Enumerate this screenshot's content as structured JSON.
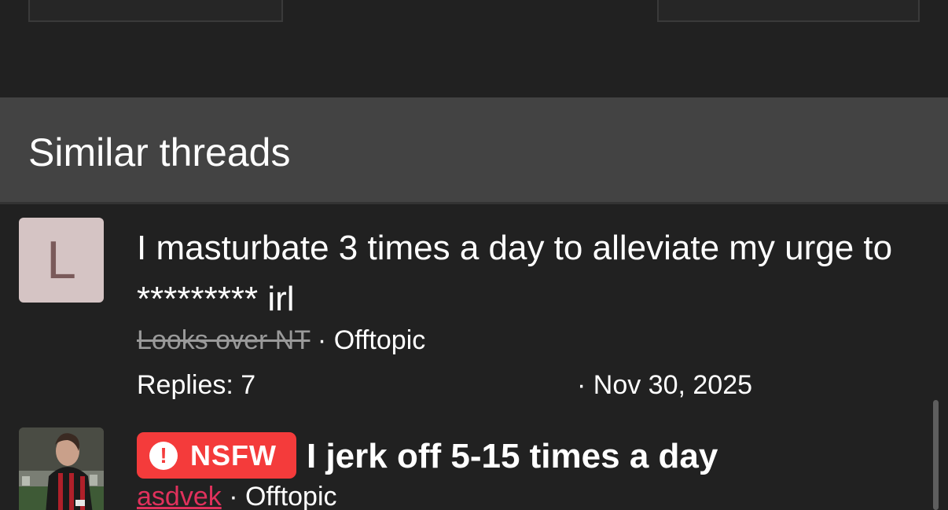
{
  "section": {
    "title": "Similar threads"
  },
  "threads": [
    {
      "avatar_letter": "L",
      "title": "I masturbate 3 times a day to alleviate my urge to ********* irl",
      "author": "Looks over NT",
      "separator": "·",
      "forum": "Offtopic",
      "replies_label": "Replies: 7",
      "date": "· Nov 30, 2025"
    },
    {
      "badge": "NSFW",
      "badge_icon": "!",
      "title": "I jerk off 5-15 times a day",
      "author": "asdvek",
      "separator": "·",
      "forum": "Offtopic"
    }
  ],
  "colors": {
    "background": "#212121",
    "header_bg": "#434343",
    "nsfw_red": "#f43b3b",
    "author_red": "#e0315c",
    "avatar_bg": "#d5c4c4"
  }
}
